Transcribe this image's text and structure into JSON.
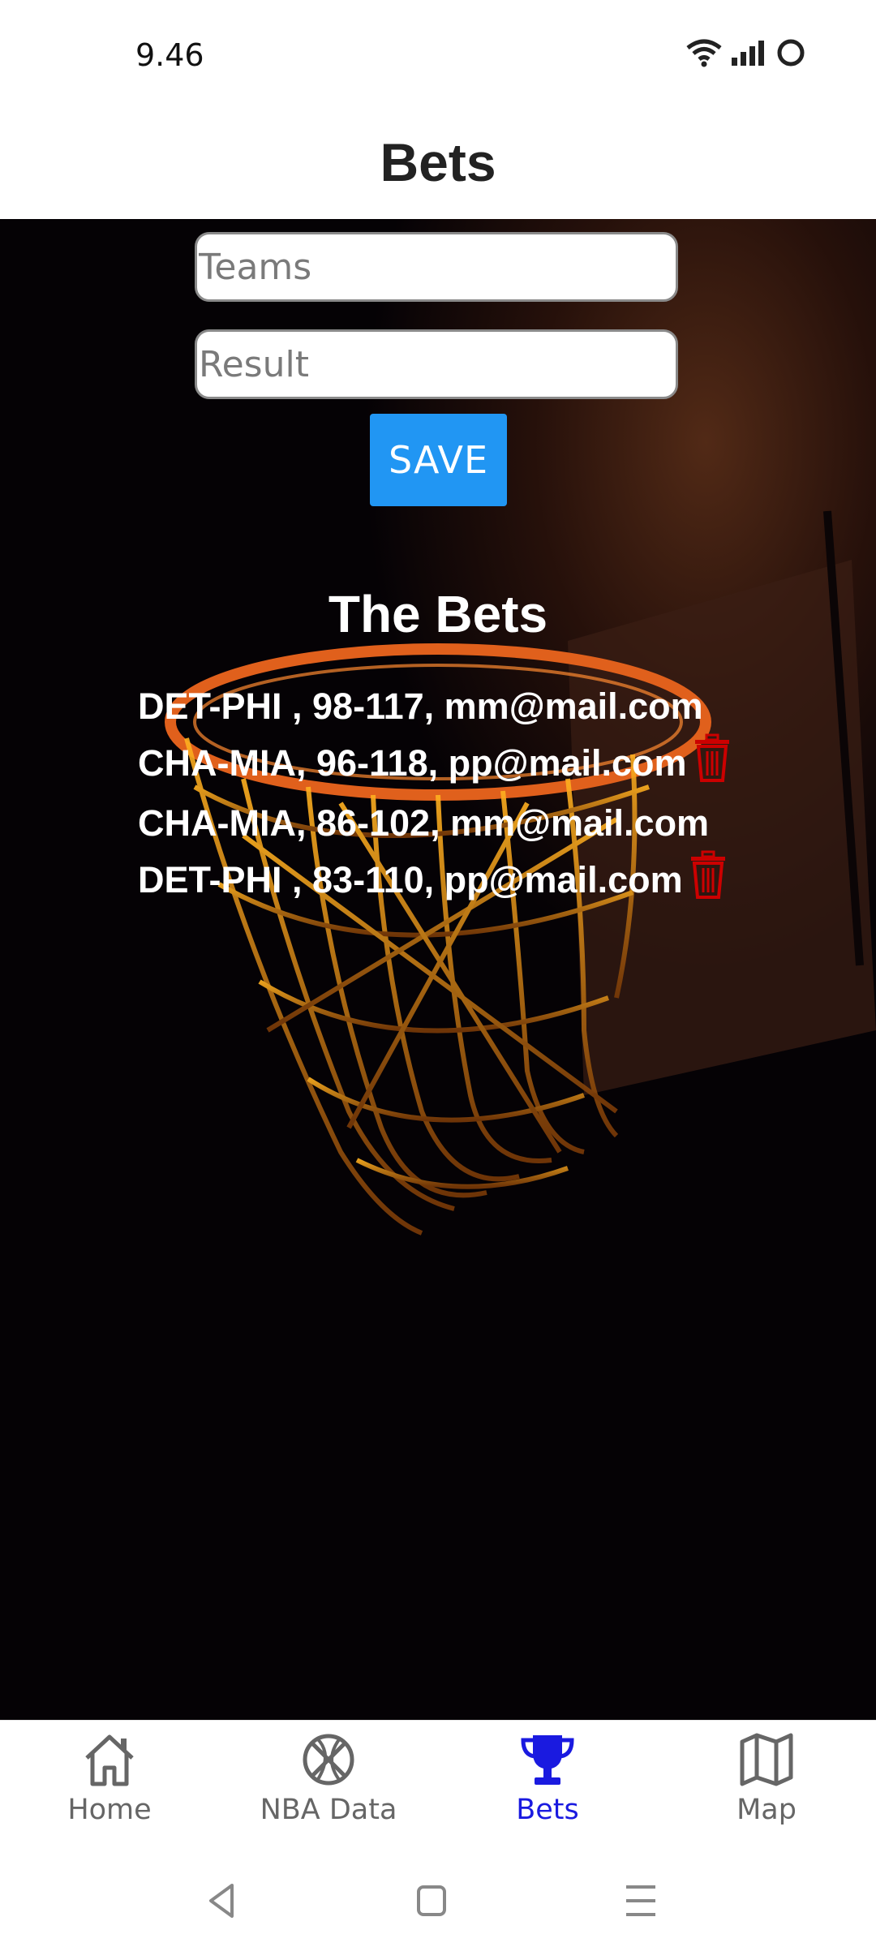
{
  "status": {
    "time": "9.46"
  },
  "header": {
    "title": "Bets"
  },
  "form": {
    "teams_placeholder": "Teams",
    "result_placeholder": "Result",
    "save_label": "SAVE"
  },
  "bets": {
    "heading": "The Bets",
    "items": [
      {
        "line1": "DET-PHI , 98-117, mm@mail.com",
        "line2": "CHA-MIA, 96-118, pp@mail.com"
      },
      {
        "line1": "CHA-MIA, 86-102, mm@mail.com",
        "line2": "DET-PHI , 83-110, pp@mail.com"
      }
    ]
  },
  "nav": {
    "items": [
      {
        "label": "Home",
        "icon": "home-icon",
        "active": false
      },
      {
        "label": "NBA Data",
        "icon": "basketball-icon",
        "active": false
      },
      {
        "label": "Bets",
        "icon": "trophy-icon",
        "active": true
      },
      {
        "label": "Map",
        "icon": "map-icon",
        "active": false
      }
    ],
    "active_color": "#1a1ae0"
  },
  "colors": {
    "save_button": "#2196F3",
    "delete_icon": "#cc0000"
  }
}
